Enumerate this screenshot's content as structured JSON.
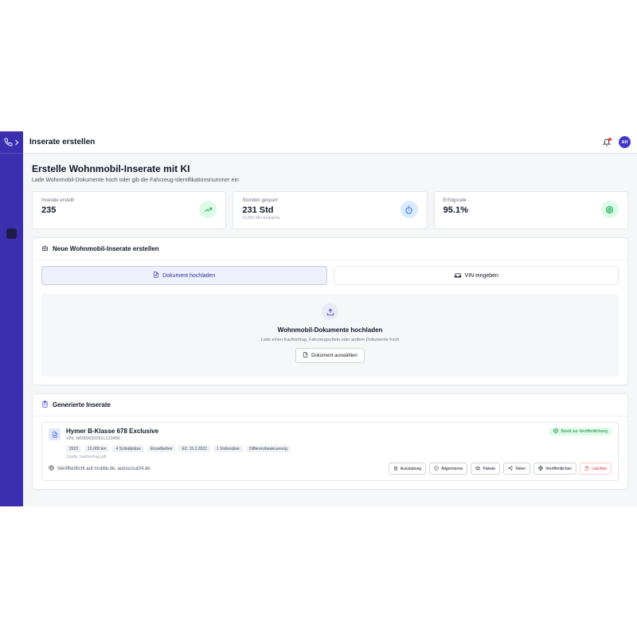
{
  "topbar": {
    "title": "Inserate erstellen",
    "avatar_initials": "AH"
  },
  "sidebar": {
    "items": [
      "",
      "",
      "",
      "",
      "",
      "",
      "",
      "",
      ""
    ]
  },
  "page": {
    "title": "Erstelle Wohnmobil-Inserate mit KI",
    "subtitle": "Lade Wohnmobil-Dokumente hoch oder gib die Fahrzeug-Identifikationsnummer ein"
  },
  "stats": [
    {
      "label": "Inserate erstellt",
      "value": "235",
      "note": "",
      "icon": "trending-up-icon",
      "color": "#16a34a",
      "bg": "#dcfce7"
    },
    {
      "label": "Stunden gespart",
      "value": "231 Std",
      "note": "13.865 Min Ersparnis",
      "icon": "timer-icon",
      "color": "#2563eb",
      "bg": "#dbeafe"
    },
    {
      "label": "Erfolgsrate",
      "value": "95.1%",
      "note": "",
      "icon": "target-icon",
      "color": "#16a34a",
      "bg": "#dcfce7"
    }
  ],
  "create": {
    "title": "Neue Wohnmobil-Inserate erstellen",
    "tab_upload": "Dokument hochladen",
    "tab_vin": "VIN eingeben",
    "dropzone_title": "Wohnmobil-Dokumente hochladen",
    "dropzone_sub": "Lade einen Kaufvertrag, Fahrzeugschein oder andere Dokumente hoch",
    "select_button": "Dokument auswählen"
  },
  "generated": {
    "title": "Generierte Inserate",
    "listing": {
      "title": "Hymer B-Klasse 678 Exclusive",
      "vin": "VIN: WDB9630291L123456",
      "status": "Bereit zur Veröffentlichung",
      "tags": [
        "2022",
        "15.000 km",
        "4 Schlafplätze",
        "Einzelbetten",
        "EZ: 15.3.2022",
        "1 Vorbesitzer",
        "Differenzbesteuerung"
      ],
      "source": "Quelle: kaufvertrag.pdf",
      "published": "Veröffentlicht auf mobile.de, autoscout24.de",
      "actions": [
        "Ausstattung",
        "Allgemeines",
        "Pakete",
        "Teilen",
        "Veröffentlichen",
        "Löschen"
      ]
    }
  },
  "colors": {
    "sidebar": "#3b2fb0",
    "accent": "#4338ca",
    "danger": "#dc2626",
    "success": "#16a34a"
  }
}
